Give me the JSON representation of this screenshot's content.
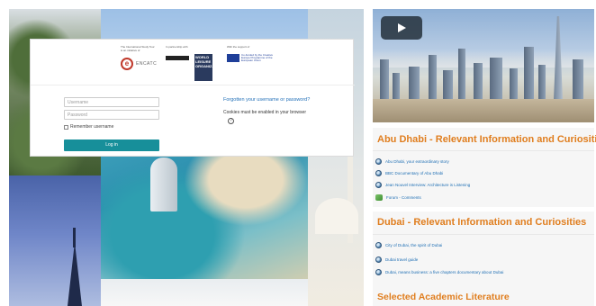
{
  "login": {
    "logos": {
      "encatc_caption": "The International Study Tour is an initiative of",
      "encatc_name": "ENCATC",
      "partner_caption": "In partnership with",
      "wlo_name": "WORLD LEISURE ORGANIZATION",
      "eu_caption": "With the support of",
      "eu_text": "Co-funded by the Creative Europe Programme of the European Union"
    },
    "username_placeholder": "Username",
    "password_placeholder": "Password",
    "remember_label": "Remember username",
    "login_button": "Log in",
    "forgot_link": "Forgotten your username or password?",
    "cookies_note": "Cookies must be enabled in your browser",
    "help_glyph": "?"
  },
  "video": {
    "play_icon": "play-icon"
  },
  "sections": [
    {
      "title": "Abu Dhabi - Relevant Information and Curiosities",
      "items": [
        {
          "icon": "url-icon",
          "label": "Abu Dhabi, your extraordinary story"
        },
        {
          "icon": "url-icon",
          "label": "BBC Documentary of Abu Dhabi"
        },
        {
          "icon": "url-icon",
          "label": "Jean Nouvel Interview: Architecture is Listening"
        },
        {
          "icon": "forum-icon",
          "label": "Forum - Comments"
        }
      ]
    },
    {
      "title": "Dubai - Relevant Information and Curiosities",
      "items": [
        {
          "icon": "url-icon",
          "label": "City of Dubai, the spirit of Dubai"
        },
        {
          "icon": "url-icon",
          "label": "Dubai travel guide"
        },
        {
          "icon": "url-icon",
          "label": "Dubai, means business: a five chapters documentary about Dubai"
        }
      ]
    },
    {
      "title": "Selected Academic Literature",
      "items": []
    }
  ]
}
